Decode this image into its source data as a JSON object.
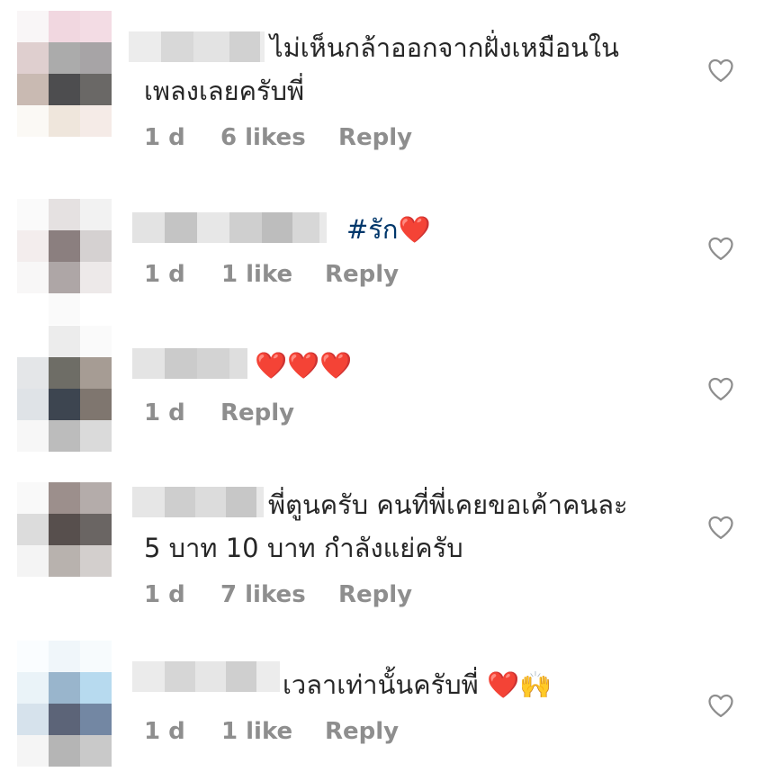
{
  "comments": [
    {
      "text_line1": "ไม่เห็นกล้าออกจากฝั่งเหมือนใน",
      "text_line2": "เพลงเลยครับพี่",
      "time": "1 d",
      "likes": "6 likes",
      "reply_label": "Reply"
    },
    {
      "hashtag": "#รัก",
      "emoji": "❤️",
      "time": "1 d",
      "likes": "1 like",
      "reply_label": "Reply"
    },
    {
      "emoji": "❤️❤️❤️",
      "time": "1 d",
      "reply_label": "Reply"
    },
    {
      "text_line1": "พี่ตูนครับ คนที่พี่เคยขอเค้าคนละ",
      "text_line2": "5 บาท 10 บาท กำลังแย่ครับ",
      "time": "1 d",
      "likes": "7 likes",
      "reply_label": "Reply"
    },
    {
      "text_line1": "เวลาเท่านั้นครับพี่ ",
      "emoji": "❤️🙌",
      "time": "1 d",
      "likes": "1 like",
      "reply_label": "Reply"
    }
  ],
  "icons": {
    "like": "heart-outline-icon"
  },
  "colors": {
    "text": "#262626",
    "meta": "#8e8e8e",
    "hashtag": "#00376b",
    "heart": "#e0112b"
  }
}
